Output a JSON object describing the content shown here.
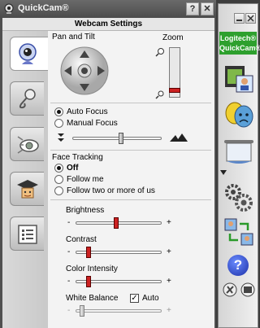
{
  "window": {
    "title": "QuickCam®",
    "help_label": "?",
    "close_label": "✕",
    "header": "Webcam Settings"
  },
  "tabs": [
    {
      "icon": "webcam-icon",
      "active": true
    },
    {
      "icon": "microphone-icon",
      "active": false
    },
    {
      "icon": "eye-icon",
      "active": false
    },
    {
      "icon": "graduation-cap-icon",
      "active": false
    },
    {
      "icon": "settings-list-icon",
      "active": false
    }
  ],
  "pan_tilt": {
    "label": "Pan and Tilt"
  },
  "zoom": {
    "label": "Zoom",
    "level": 0.1
  },
  "focus": {
    "auto_label": "Auto Focus",
    "manual_label": "Manual Focus",
    "selected": "auto",
    "level": 0.55
  },
  "face_tracking": {
    "label": "Face Tracking",
    "options": [
      "Off",
      "Follow me",
      "Follow two or more of us"
    ],
    "selected": "Off"
  },
  "brightness": {
    "label": "Brightness",
    "level": 0.47,
    "minus": "-",
    "plus": "+"
  },
  "contrast": {
    "label": "Contrast",
    "level": 0.13,
    "minus": "-",
    "plus": "+"
  },
  "color_intensity": {
    "label": "Color Intensity",
    "level": 0.13,
    "minus": "-",
    "plus": "+"
  },
  "white_balance": {
    "label": "White Balance",
    "auto_label": "Auto",
    "auto_checked": true,
    "check_mark": "✓",
    "level": 0.05,
    "minus": "-",
    "plus": "+"
  },
  "dock": {
    "logo_line1": "Logitech®",
    "logo_line2": "QuickCam®",
    "help_label": "?",
    "colors": {
      "accent": "#2ea02e",
      "slider": "#cc2222"
    }
  }
}
